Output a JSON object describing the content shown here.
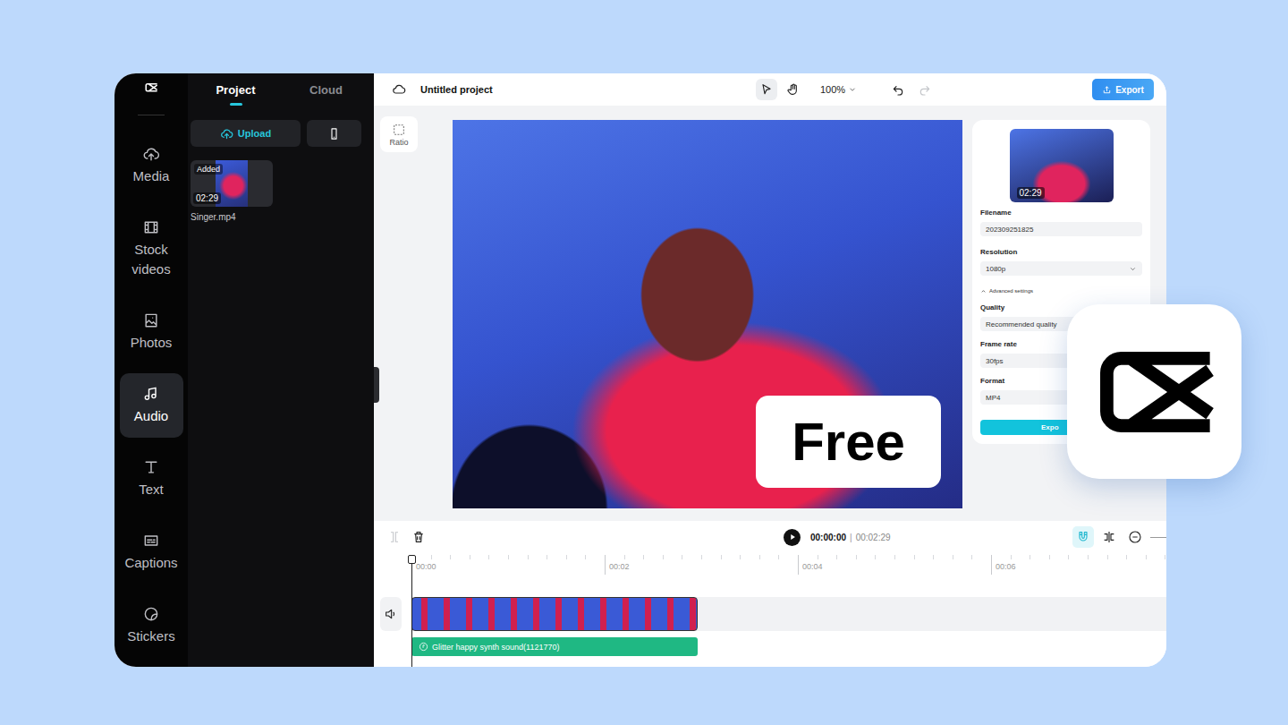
{
  "app": {
    "project_title": "Untitled project",
    "zoom": "100%",
    "export_button": "Export"
  },
  "tools": [
    {
      "kind": "pointer",
      "selected": true
    },
    {
      "kind": "hand",
      "selected": false
    }
  ],
  "history": [
    {
      "kind": "undo",
      "disabled": false
    },
    {
      "kind": "redo",
      "disabled": true
    }
  ],
  "sidebar": {
    "items": [
      {
        "label": "Media",
        "selected": false
      },
      {
        "label": "Stock videos",
        "selected": false
      },
      {
        "label": "Photos",
        "selected": false
      },
      {
        "label": "Audio",
        "selected": true
      },
      {
        "label": "Text",
        "selected": false
      },
      {
        "label": "Captions",
        "selected": false
      },
      {
        "label": "Stickers",
        "selected": false
      }
    ]
  },
  "media_panel": {
    "tabs": [
      {
        "label": "Project",
        "selected": true
      },
      {
        "label": "Cloud",
        "selected": false
      }
    ],
    "upload_button": "Upload",
    "files": [
      {
        "badge": "Added",
        "duration": "02:29",
        "name": "Singer.mp4"
      }
    ]
  },
  "canvas": {
    "ratio_button": "Ratio",
    "badge": "Free"
  },
  "export_panel": {
    "duration": "02:29",
    "fields": [
      {
        "label": "Filename",
        "value": "202309251825",
        "kind": "text"
      },
      {
        "label": "Resolution",
        "value": "1080p",
        "kind": "select"
      }
    ],
    "advanced": {
      "label": "Advanced settings",
      "expanded": true
    },
    "advanced_fields": [
      {
        "label": "Quality",
        "value": "Recommended quality",
        "kind": "text"
      },
      {
        "label": "Frame rate",
        "value": "30fps",
        "kind": "text"
      },
      {
        "label": "Format",
        "value": "MP4",
        "kind": "text"
      }
    ],
    "button": "Expo"
  },
  "timeline": {
    "current_time": "00:00:00",
    "separator": "|",
    "total_time": "00:02:29",
    "ruler": [
      "00:00",
      "00:02",
      "00:04",
      "00:06"
    ],
    "audio_clip": "Glitter happy synth sound(1121770)",
    "tools": [
      {
        "kind": "magnet",
        "selected": true
      },
      {
        "kind": "split",
        "selected": false
      },
      {
        "kind": "zoom-out",
        "selected": false
      }
    ]
  }
}
